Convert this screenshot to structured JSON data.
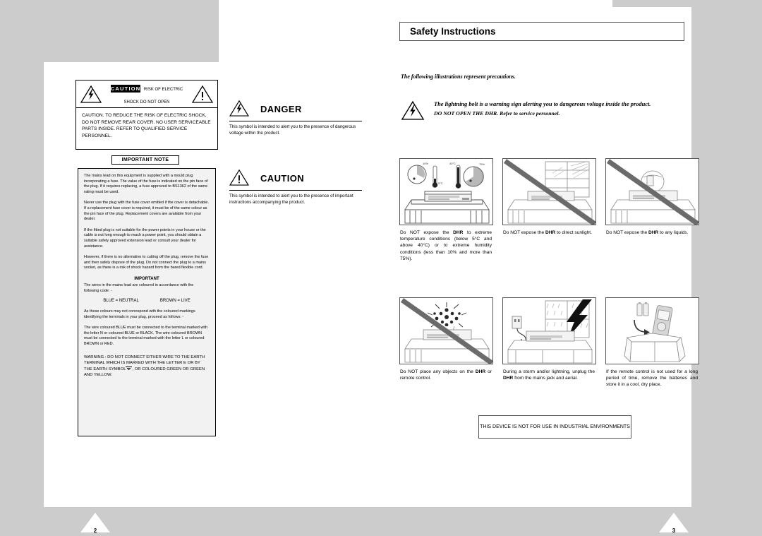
{
  "document": {
    "left_page_number": "2",
    "right_page_number": "3"
  },
  "left_page": {
    "caution_box": {
      "header": "CAUTION",
      "subtitle_line1": "RISK OF ELECTRIC",
      "subtitle_line2": "SHOCK DO NOT OPEN",
      "body": "CAUTION. TO REDUCE THE RISK OF ELECTRIC SHOCK, DO NOT REMOVE REAR COVER. NO USER SERVICEABLE PARTS INSIDE. REFER TO QUALIFIED SERVICE PERSONNEL.",
      "left_icon": "lightning-bolt-triangle-icon",
      "right_icon": "exclamation-triangle-icon"
    },
    "important_note": {
      "title": "IMPORTANT NOTE",
      "paragraphs": [
        "The mains lead on this equipment is supplied with a mould plug incorporating a fuse. The value of the fuse is indicated on the pin face of the plug. If it requires replacing, a fuse approved to BS1362 of the same rating must be used.",
        "Never use the plug with the fuse cover omitted if the cover is detachable. If a replacement fuse cover is required, it must be of the same colour as the pin face of the plug.\nReplacement covers are available from your dealer.",
        "If the fitted plug is not suitable for the power points in your house or the cable is not long enough to reach a power point, you should obtain a suitable safety approved extension lead or consult your dealer for assistance.",
        "However, if there is no alternative to cutting off the plug, remove the fuse and then safely dispose of the plug.\nDo not connect the plug to a mains socket, as there is a risk of shock hazard from the bared flexible cord."
      ],
      "important_heading": "IMPORTANT",
      "code_intro": "The wires in the mains lead are coloured in accordance with the following code: -",
      "code_blue": "BLUE = NEUTRAL",
      "code_brown": "BROWN = LIVE",
      "colours_para": "As these colours may not correspond with the coloured markings identifying the terminals in your plug, proceed as follows: -",
      "wire_para": "The wire coloured BLUE must be connected to the terminal marked with the letter N or coloured BLUE or BLACK. The wire coloured BROWN must be connected to the terminal marked with the letter L or coloured BROWN or RED.",
      "warning_part1": "WARNING : DO NOT CONNECT EITHER WIRE TO THE EARTH TERMINAL WHICH IS MARKED WITH THE LETTER E OR BY THE EARTH SYMBOL",
      "warning_part2": ", OR COLOURED GREEN OR GREEN AND YELLOW."
    },
    "danger": {
      "icon": "lightning-bolt-triangle-icon",
      "word": "DANGER",
      "description": "This symbol is intended to alert you to the presence of dangerous voltage within the product."
    },
    "caution": {
      "icon": "exclamation-triangle-icon",
      "word": "CAUTION",
      "description": "This symbol is intended to alert you to the presence of important instructions accompanying the product."
    }
  },
  "right_page": {
    "title": "Safety Instructions",
    "intro": "The following illustrations represent precautions.",
    "bolt_note": {
      "icon": "lightning-bolt-triangle-icon",
      "line1": "The lightning bolt is a warning sign alerting you to dangerous voltage inside the product.",
      "line2": "DO NOT OPEN THE DHR. Refer to service personnel."
    },
    "precautions": [
      {
        "illustration": "temperature-humidity-illustration",
        "caption_pre": "Do NOT expose the ",
        "caption_bold": "DHR",
        "caption_post": " to extreme temperature conditions (below 5°C and above 40°C) or to extreme humidity conditions (less than 10% and more than 75%).",
        "labels": {
          "humidity_low": "10%",
          "humidity_high": "75%",
          "temp_low": "5°C",
          "temp_high": "40°C"
        },
        "slashed": false
      },
      {
        "illustration": "direct-sunlight-illustration",
        "caption_pre": "Do NOT expose the ",
        "caption_bold": "DHR",
        "caption_post": " to direct sunlight.",
        "slashed": true
      },
      {
        "illustration": "liquids-illustration",
        "caption_pre": "Do NOT expose the ",
        "caption_bold": "DHR",
        "caption_post": " to any liquids.",
        "slashed": true
      },
      {
        "illustration": "objects-on-device-illustration",
        "caption_pre": "Do NOT place any objects on the ",
        "caption_bold": "DHR",
        "caption_post": " or remote control.",
        "slashed": true
      },
      {
        "illustration": "storm-lightning-illustration",
        "caption_pre": "During a storm and/or lightning, unplug the ",
        "caption_bold": "DHR",
        "caption_post": " from the mains jack and aerial.",
        "slashed": false
      },
      {
        "illustration": "remote-storage-illustration",
        "caption_pre": "If the remote control is not used for a long period of time, remove the batteries and store it in a cool, dry place.",
        "caption_bold": "",
        "caption_post": "",
        "slashed": false
      }
    ],
    "notice": "THIS DEVICE IS NOT FOR USE IN INDUSTRIAL ENVIRONMENTS"
  }
}
